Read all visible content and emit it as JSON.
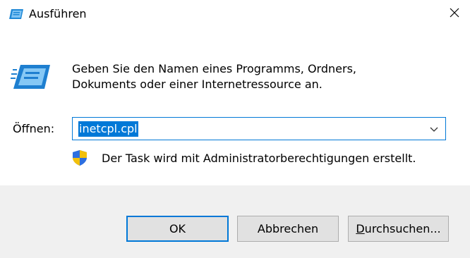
{
  "window": {
    "title": "Ausführen",
    "close_glyph": "✕",
    "title_icon": "run-icon"
  },
  "description": {
    "line1": "Geben Sie den Namen eines Programms, Ordners,",
    "line2": "Dokuments oder einer Internetressource an.",
    "icon": "run-icon"
  },
  "open_field": {
    "label": "Öffnen:",
    "value": "inetcpl.cpl",
    "dropdown_icon": "chevron-down-icon",
    "highlight_color": "#0078d7"
  },
  "admin_note": {
    "icon": "shield-icon",
    "text": "Der Task wird mit Administratorberechtigungen erstellt."
  },
  "buttons": {
    "ok_label": "OK",
    "cancel_label": "Abbrechen",
    "browse_mnemonic": "D",
    "browse_rest": "urchsuchen..."
  },
  "colors": {
    "accent": "#0078d7",
    "footer_bg": "#f0f0f0",
    "button_bg": "#e1e1e1"
  }
}
